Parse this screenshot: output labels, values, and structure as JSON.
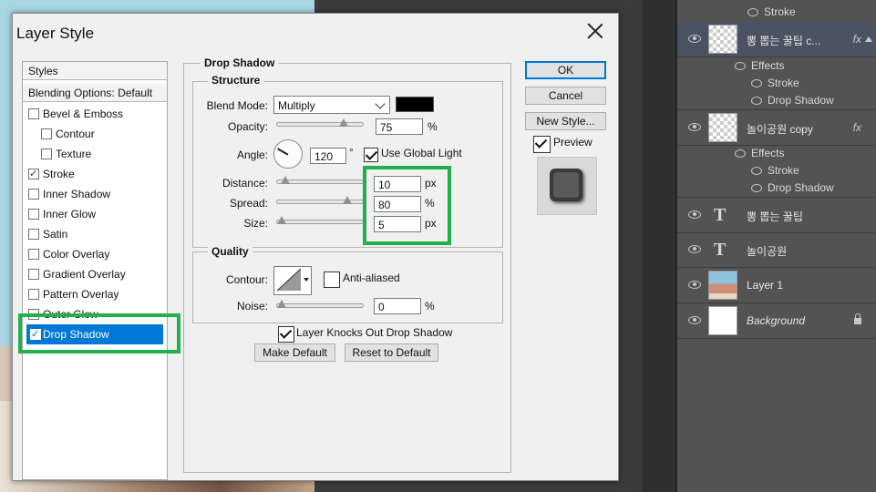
{
  "dialog": {
    "title": "Layer Style",
    "styles_header": "Styles",
    "blending_options": "Blending Options: Default",
    "styles": [
      {
        "label": "Bevel & Emboss",
        "checked": false
      },
      {
        "label": "Contour",
        "checked": false
      },
      {
        "label": "Texture",
        "checked": false
      },
      {
        "label": "Stroke",
        "checked": true
      },
      {
        "label": "Inner Shadow",
        "checked": false
      },
      {
        "label": "Inner Glow",
        "checked": false
      },
      {
        "label": "Satin",
        "checked": false
      },
      {
        "label": "Color Overlay",
        "checked": false
      },
      {
        "label": "Gradient Overlay",
        "checked": false
      },
      {
        "label": "Pattern Overlay",
        "checked": false
      },
      {
        "label": "Outer Glow",
        "checked": false
      },
      {
        "label": "Drop Shadow",
        "checked": true,
        "selected": true
      }
    ],
    "section_title": "Drop Shadow",
    "structure": {
      "title": "Structure",
      "blend_mode_label": "Blend Mode:",
      "blend_mode_value": "Multiply",
      "shadow_color": "#000000",
      "opacity_label": "Opacity:",
      "opacity_value": "75",
      "opacity_unit": "%",
      "angle_label": "Angle:",
      "angle_value": "120",
      "angle_unit": "°",
      "use_global_light_label": "Use Global Light",
      "use_global_light": true,
      "distance_label": "Distance:",
      "distance_value": "10",
      "distance_unit": "px",
      "spread_label": "Spread:",
      "spread_value": "80",
      "spread_unit": "%",
      "size_label": "Size:",
      "size_value": "5",
      "size_unit": "px"
    },
    "quality": {
      "title": "Quality",
      "contour_label": "Contour:",
      "anti_aliased_label": "Anti-aliased",
      "anti_aliased": false,
      "noise_label": "Noise:",
      "noise_value": "0",
      "noise_unit": "%"
    },
    "knockout_label": "Layer Knocks Out Drop Shadow",
    "knockout": true,
    "make_default_label": "Make Default",
    "reset_default_label": "Reset to Default",
    "ok_label": "OK",
    "cancel_label": "Cancel",
    "new_style_label": "New Style...",
    "preview_label": "Preview",
    "preview": true
  },
  "layers": {
    "top_effect": "Stroke",
    "items": [
      {
        "name": "뽕 뽑는 꿀팁 c...",
        "fx": "fx",
        "effects_label": "Effects",
        "effects": [
          "Stroke",
          "Drop Shadow"
        ]
      },
      {
        "name": "놀이공원 copy",
        "fx": "fx",
        "effects_label": "Effects",
        "effects": [
          "Stroke",
          "Drop Shadow"
        ]
      },
      {
        "name": "뽕 뽑는 꿀팁",
        "type_icon": "T"
      },
      {
        "name": "놀이공원",
        "type_icon": "T"
      },
      {
        "name": "Layer 1"
      },
      {
        "name": "Background"
      }
    ]
  },
  "colors": {
    "highlight": "#21b04b",
    "selection": "#0078d7",
    "panel": "#535353"
  }
}
